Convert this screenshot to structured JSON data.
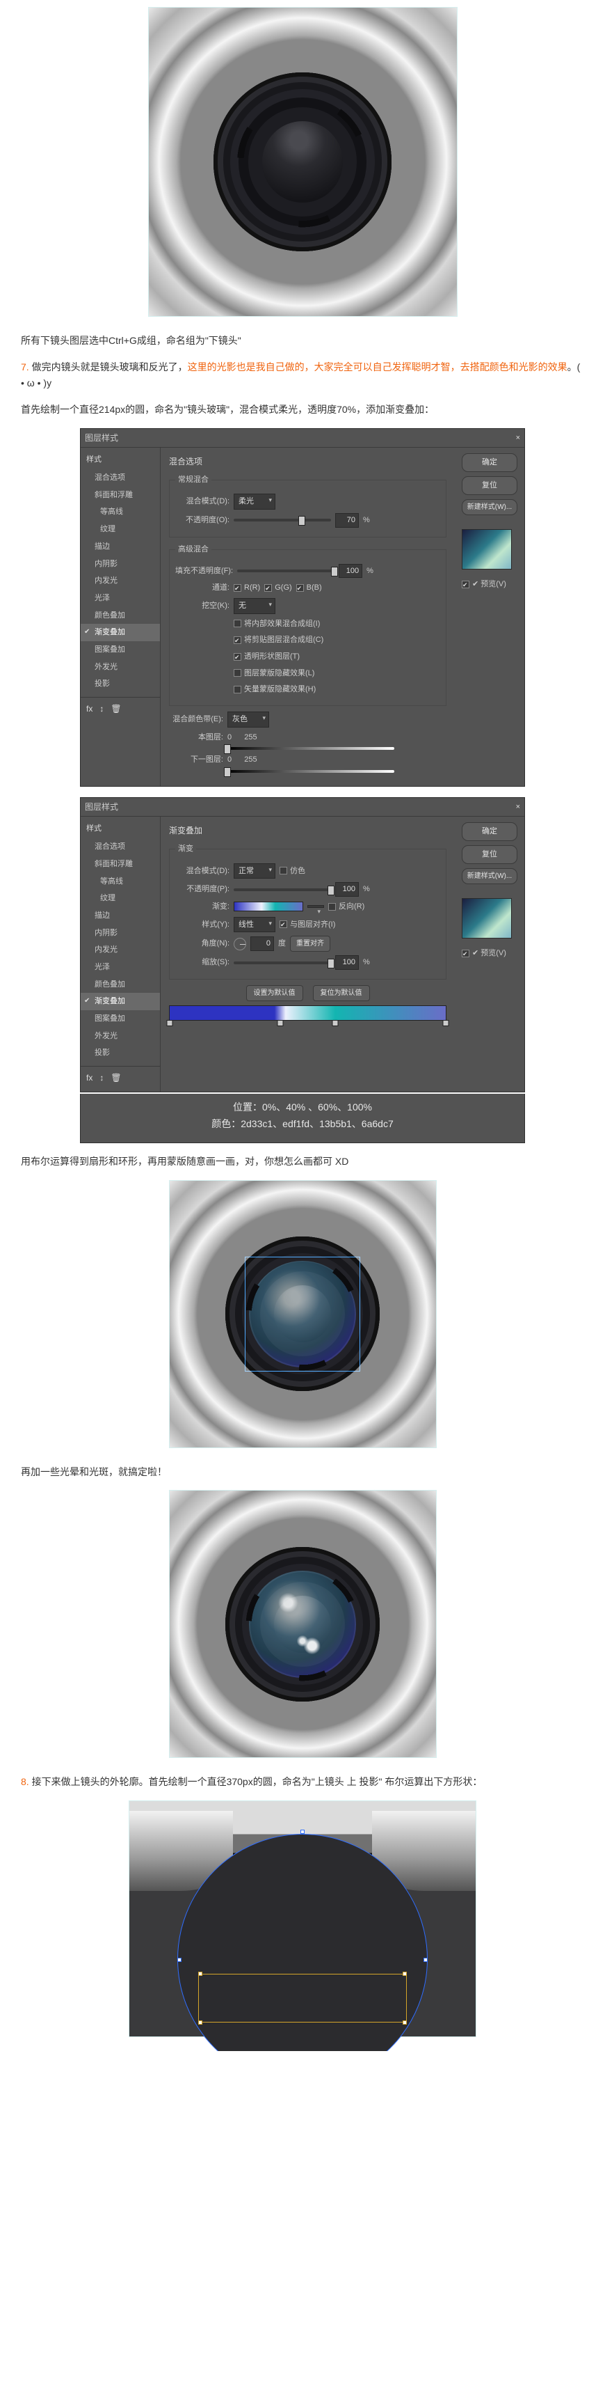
{
  "img_desc": {
    "border_note": ""
  },
  "para1": "所有下镜头图层选中Ctrl+G成组，命名组为\"下镜头\"",
  "step7": {
    "num": "7. ",
    "text_a": "做完内镜头就是镜头玻璃和反光了，",
    "hl": "这里的光影也是我自己做的，大家完全可以自己发挥聪明才智，去搭配颜色和光影的效果",
    "text_b": "。( • ω • )y",
    "line2": "首先绘制一个直径214px的圆，命名为\"镜头玻璃\"，混合模式柔光，透明度70%，添加渐变叠加："
  },
  "dialog": {
    "title": "图层样式",
    "close": "×",
    "sidebar_head": "样式",
    "items": [
      {
        "label": "混合选项",
        "checked": false,
        "sel": false,
        "ind": false
      },
      {
        "label": "斜面和浮雕",
        "checked": false,
        "sel": false,
        "ind": false
      },
      {
        "label": "等高线",
        "checked": false,
        "sel": false,
        "ind": true
      },
      {
        "label": "纹理",
        "checked": false,
        "sel": false,
        "ind": true
      },
      {
        "label": "描边",
        "checked": false,
        "sel": false,
        "ind": false
      },
      {
        "label": "内阴影",
        "checked": false,
        "sel": false,
        "ind": false
      },
      {
        "label": "内发光",
        "checked": false,
        "sel": false,
        "ind": false
      },
      {
        "label": "光泽",
        "checked": false,
        "sel": false,
        "ind": false
      },
      {
        "label": "颜色叠加",
        "checked": false,
        "sel": false,
        "ind": false
      },
      {
        "label": "渐变叠加",
        "checked": true,
        "sel": true,
        "ind": false
      },
      {
        "label": "图案叠加",
        "checked": false,
        "sel": false,
        "ind": false
      },
      {
        "label": "外发光",
        "checked": false,
        "sel": false,
        "ind": false
      },
      {
        "label": "投影",
        "checked": false,
        "sel": false,
        "ind": false
      }
    ],
    "foot_icons": [
      "fx",
      "↕",
      "🗑"
    ],
    "buttons": {
      "ok": "确定",
      "cancel": "复位",
      "new": "新建样式(W)...",
      "preview": "✔ 预览(V)"
    }
  },
  "panelA": {
    "title": "混合选项",
    "group1": "常规混合",
    "blend_label": "混合模式(D):",
    "blend_value": "柔光",
    "opac_label": "不透明度(O):",
    "opac_value": "70",
    "pct": "%",
    "group2": "高级混合",
    "fill_label": "填充不透明度(F):",
    "fill_value": "100",
    "chan_label": "通道:",
    "chan_r": "R(R)",
    "chan_g": "G(G)",
    "chan_b": "B(B)",
    "knock_label": "挖空(K):",
    "knock_value": "无",
    "chk1": "将内部效果混合成组(I)",
    "chk2": "将剪贴图层混合成组(C)",
    "chk3": "透明形状图层(T)",
    "chk4": "图层蒙版隐藏效果(L)",
    "chk5": "矢量蒙版隐藏效果(H)",
    "group3": "混合颜色带(E):",
    "gray": "灰色",
    "this_label": "本图层:",
    "this_a": "0",
    "this_b": "255",
    "under_label": "下一图层:",
    "under_a": "0",
    "under_b": "255"
  },
  "panelB": {
    "title": "渐变叠加",
    "sub": "渐变",
    "blend_label": "混合模式(D):",
    "blend_value": "正常",
    "dither": "仿色",
    "opac_label": "不透明度(P):",
    "opac_value": "100",
    "pct": "%",
    "grad_label": "渐变:",
    "reverse": "反向(R)",
    "style_label": "样式(Y):",
    "style_value": "线性",
    "align": "与图层对齐(I)",
    "angle_label": "角度(N):",
    "angle_value": "0",
    "deg": "度",
    "reset": "重置对齐",
    "scale_label": "缩放(S):",
    "scale_value": "100",
    "def": "设置为默认值",
    "res": "复位为默认值"
  },
  "grad_caption": {
    "line1": "位置：0%、40% 、60%、100%",
    "line2": "颜色：2d33c1、edf1fd、13b5b1、6a6dc7"
  },
  "para2": "用布尔运算得到扇形和环形，再用蒙版随意画一画，对，你想怎么画都可 XD",
  "para3": "再加一些光晕和光斑，就搞定啦！",
  "step8": {
    "num": "8. ",
    "text": "接下来做上镜头的外轮廓。首先绘制一个直径370px的圆，命名为\"上镜头 上 投影\" 布尔运算出下方形状："
  },
  "chart_data": {
    "type": "table",
    "note": "Gradient stops for '镜头玻璃' gradient overlay",
    "columns": [
      "position_pct",
      "color_hex"
    ],
    "rows": [
      [
        0,
        "2d33c1"
      ],
      [
        40,
        "edf1fd"
      ],
      [
        60,
        "13b5b1"
      ],
      [
        100,
        "6a6dc7"
      ]
    ]
  }
}
